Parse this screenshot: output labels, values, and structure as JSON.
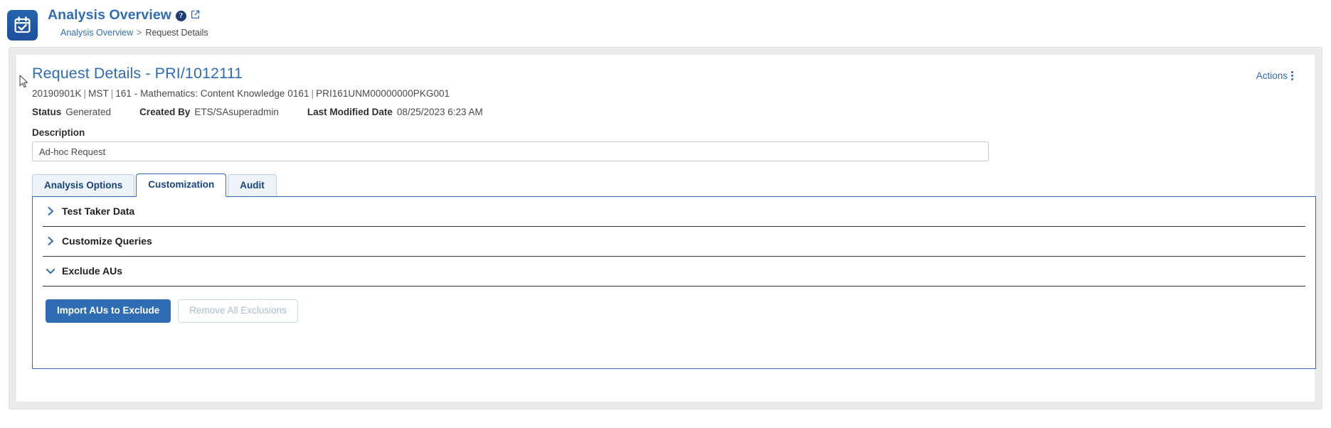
{
  "app": {
    "logo_icon": "calendar-check-icon",
    "title": "Analysis Overview",
    "help_icon": "help-circle-icon",
    "external_link_icon": "external-link-icon"
  },
  "breadcrumb": {
    "root": "Analysis Overview",
    "separator": ">",
    "current": "Request Details"
  },
  "card": {
    "title": "Request Details - PRI/1012111",
    "actions_label": "Actions",
    "actions_icon": "kebab-menu-icon",
    "meta": {
      "parts": [
        "20190901K",
        "MST",
        "161 - Mathematics: Content Knowledge 0161",
        "PRI161UNM00000000PKG001"
      ],
      "separator": "|"
    },
    "fields": [
      {
        "label": "Status",
        "value": "Generated"
      },
      {
        "label": "Created By",
        "value": "ETS/SAsuperadmin"
      },
      {
        "label": "Last Modified Date",
        "value": "08/25/2023 6:23 AM"
      }
    ],
    "description": {
      "label": "Description",
      "value": "Ad-hoc Request",
      "placeholder": "Description"
    }
  },
  "tabs": [
    {
      "label": "Analysis Options",
      "active": false
    },
    {
      "label": "Customization",
      "active": true
    },
    {
      "label": "Audit",
      "active": false
    }
  ],
  "accordions": [
    {
      "label": "Test Taker Data",
      "expanded": false,
      "chevron": "chevron-right-icon"
    },
    {
      "label": "Customize Queries",
      "expanded": false,
      "chevron": "chevron-right-icon"
    },
    {
      "label": "Exclude AUs",
      "expanded": true,
      "chevron": "chevron-down-icon"
    }
  ],
  "buttons": {
    "import": "Import AUs to Exclude",
    "remove": "Remove All Exclusions"
  },
  "colors": {
    "accent": "#2f6cb4",
    "dark_blue": "#16447e",
    "panel_gray": "#ebebeb",
    "tab_inactive": "#eef3f9"
  }
}
